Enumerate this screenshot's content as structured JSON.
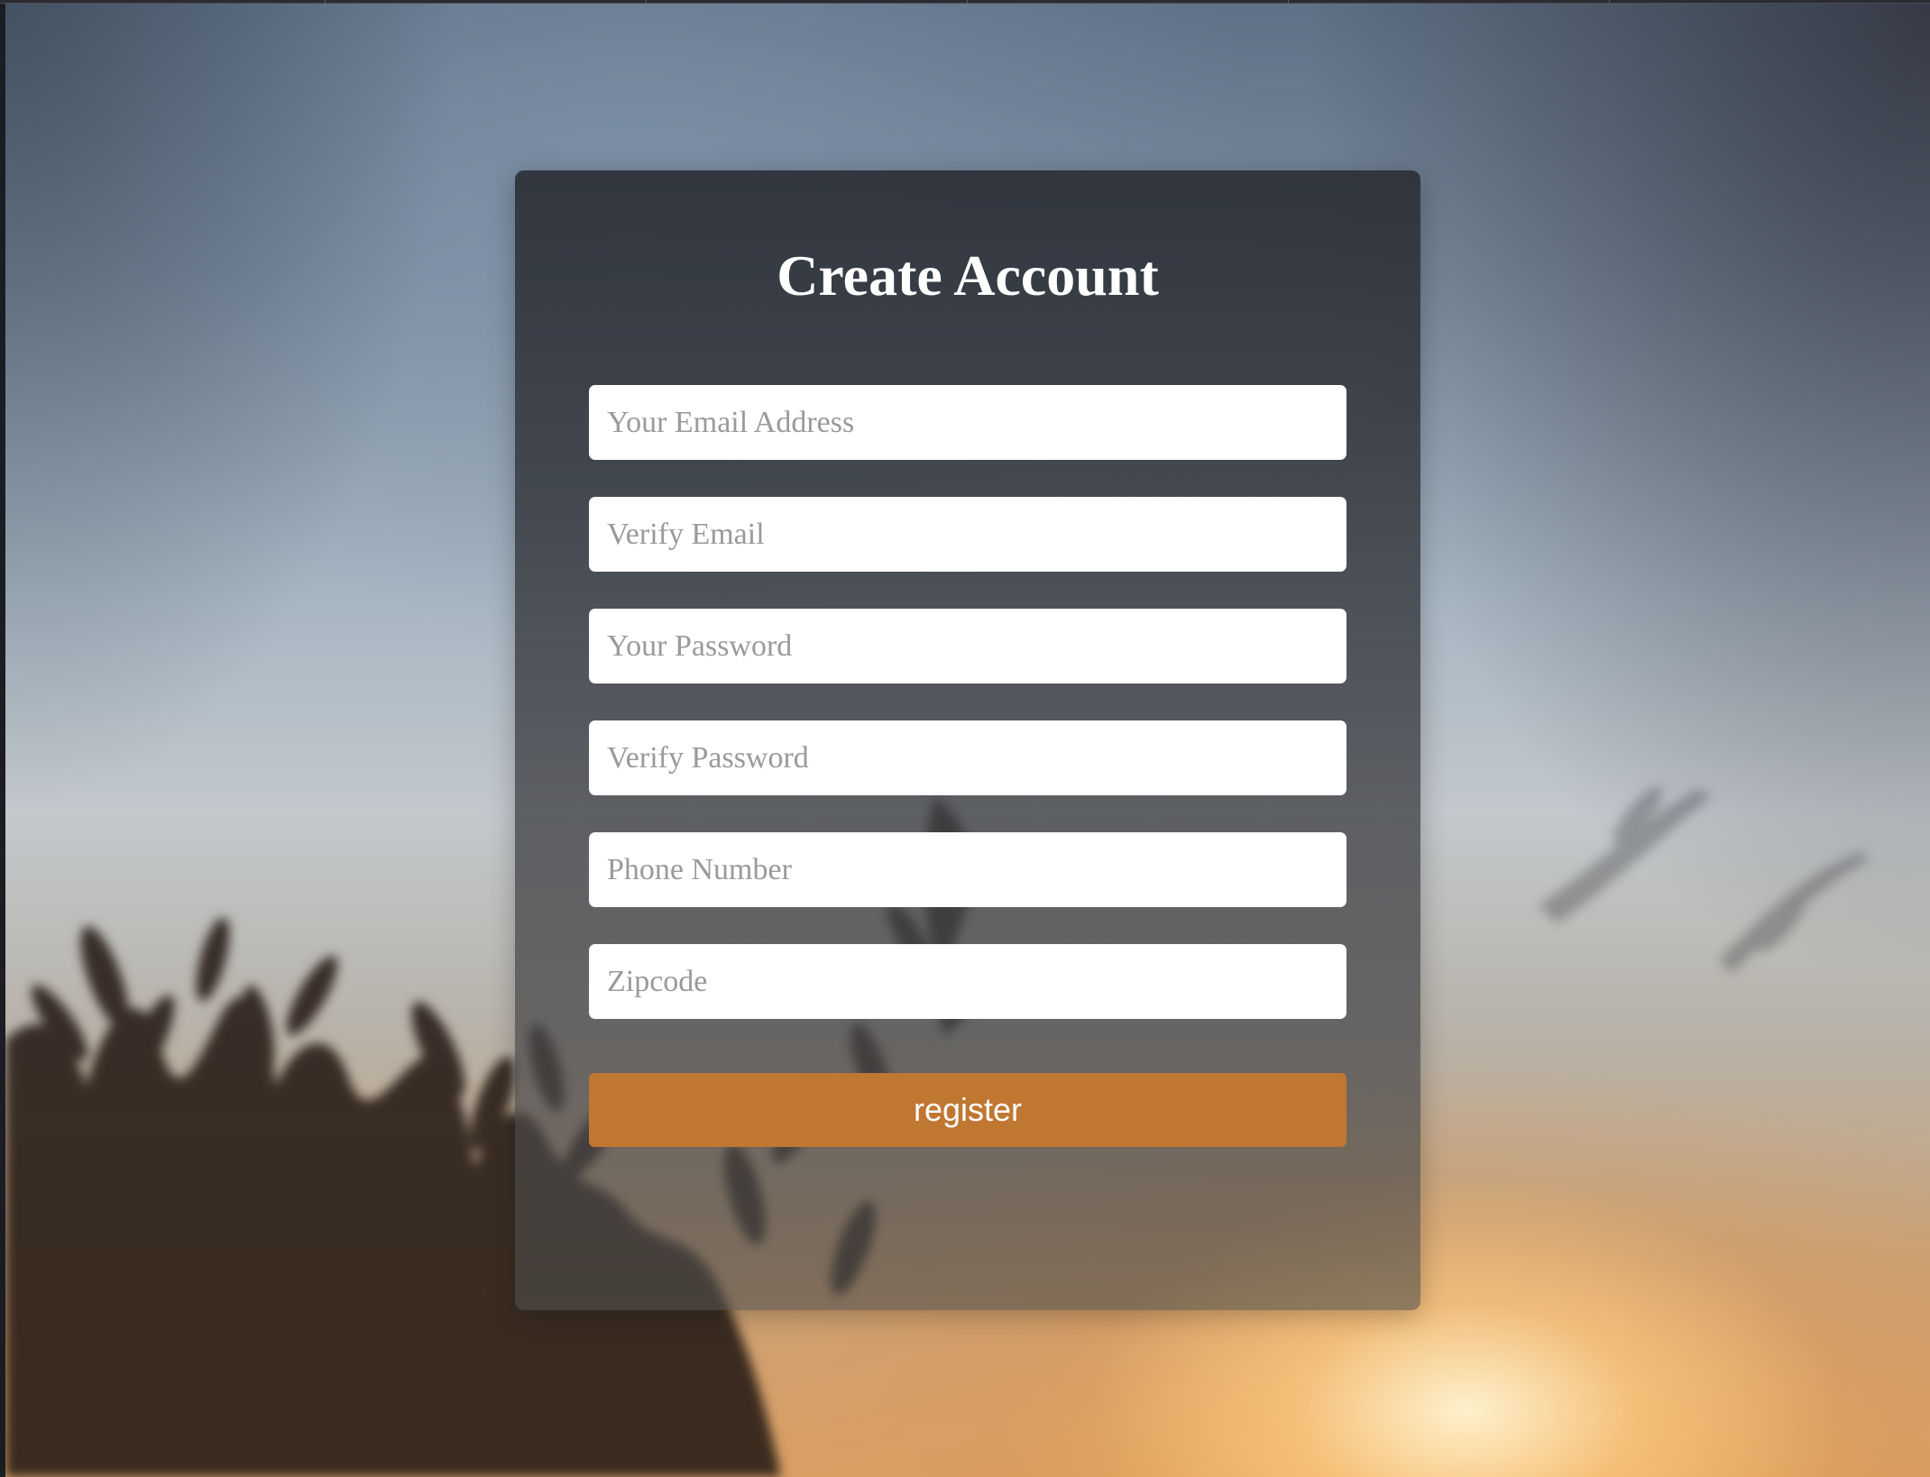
{
  "form": {
    "title": "Create Account",
    "fields": [
      {
        "name": "email",
        "placeholder": "Your Email Address",
        "value": ""
      },
      {
        "name": "verify_email",
        "placeholder": "Verify Email",
        "value": ""
      },
      {
        "name": "password",
        "placeholder": "Your Password",
        "value": ""
      },
      {
        "name": "verify_password",
        "placeholder": "Verify Password",
        "value": ""
      },
      {
        "name": "phone",
        "placeholder": "Phone Number",
        "value": ""
      },
      {
        "name": "zipcode",
        "placeholder": "Zipcode",
        "value": ""
      }
    ],
    "submit_label": "register"
  },
  "colors": {
    "button": "#c07732",
    "card": "#2c3038",
    "title_text": "#ffffff",
    "placeholder": "#9a9a9a"
  },
  "background": {
    "description_icon": "blurred-sunset-plants-image"
  }
}
